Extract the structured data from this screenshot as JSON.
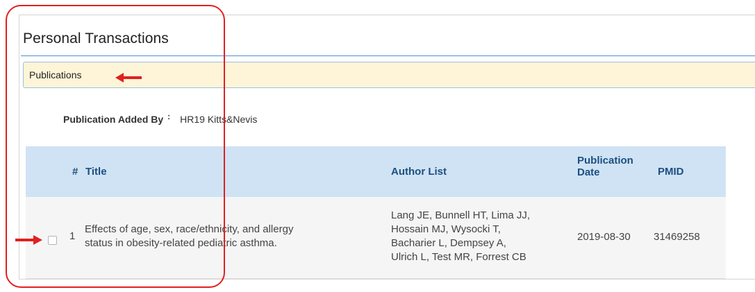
{
  "panel": {
    "title": "Personal Transactions"
  },
  "section": {
    "label": "Publications"
  },
  "added_by": {
    "label": "Publication Added By",
    "colon": ":",
    "value": "HR19 Kitts&Nevis"
  },
  "table": {
    "headers": {
      "num": "#",
      "title": "Title",
      "authors": "Author List",
      "date_line1": "Publication",
      "date_line2": "Date",
      "pmid": "PMID"
    },
    "rows": [
      {
        "num": "1",
        "title_line1": "Effects of age, sex, race/ethnicity, and allergy",
        "title_line2": "status in obesity-related pediatric asthma.",
        "authors_line1": "Lang JE, Bunnell HT, Lima JJ,",
        "authors_line2": "Hossain MJ, Wysocki T,",
        "authors_line3": "Bacharier L, Dempsey A,",
        "authors_line4": "Ulrich L, Test MR, Forrest CB",
        "date": "2019-08-30",
        "pmid": "31469258",
        "checked": false
      }
    ]
  },
  "annotations": {
    "color": "#e02020"
  },
  "colors": {
    "header_bg": "#cfe3f4",
    "header_text": "#1d4f80",
    "section_bg": "#fef5d9",
    "rule": "#4a90c8"
  }
}
